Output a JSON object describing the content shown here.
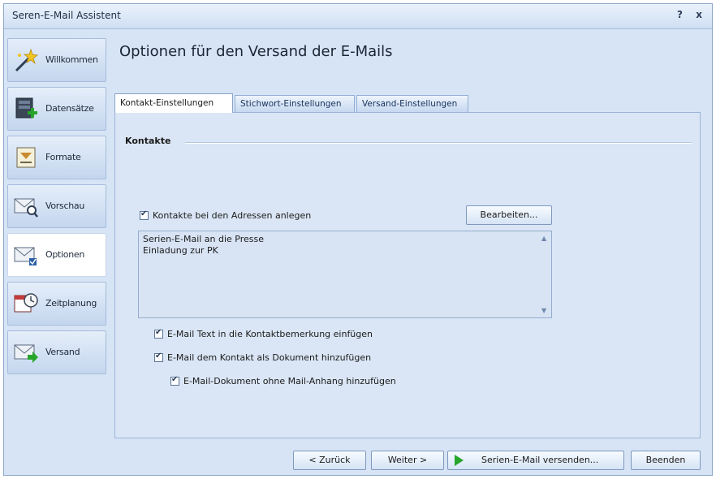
{
  "window": {
    "title": "Seren-E-Mail Assistent",
    "help_label": "?",
    "close_label": "x"
  },
  "sidebar": {
    "items": [
      {
        "label": "Willkommen",
        "icon": "magic-wand-icon",
        "active": false
      },
      {
        "label": "Datensätze",
        "icon": "database-add-icon",
        "active": false
      },
      {
        "label": "Formate",
        "icon": "format-icon",
        "active": false
      },
      {
        "label": "Vorschau",
        "icon": "mail-preview-icon",
        "active": false
      },
      {
        "label": "Optionen",
        "icon": "mail-options-icon",
        "active": true
      },
      {
        "label": "Zeitplanung",
        "icon": "calendar-clock-icon",
        "active": false
      },
      {
        "label": "Versand",
        "icon": "mail-send-icon",
        "active": false
      }
    ]
  },
  "main": {
    "heading": "Optionen für den Versand der E-Mails",
    "tabs": [
      {
        "label": "Kontakt-Einstellungen",
        "active": true
      },
      {
        "label": "Stichwort-Einstellungen",
        "active": false
      },
      {
        "label": "Versand-Einstellungen",
        "active": false
      }
    ],
    "group_title": "Kontakte",
    "create_contacts": {
      "label": "Kontakte bei den Adressen anlegen",
      "checked": true
    },
    "edit_button": "Bearbeiten...",
    "textarea_lines": [
      "Serien-E-Mail an die Presse",
      "Einladung zur PK"
    ],
    "options": [
      {
        "label": "E-Mail Text in die Kontaktbemerkung einfügen",
        "checked": true
      },
      {
        "label": "E-Mail dem Kontakt als Dokument hinzufügen",
        "checked": true
      },
      {
        "label": "E-Mail-Dokument ohne Mail-Anhang hinzufügen",
        "checked": true
      }
    ]
  },
  "footer": {
    "back": "< Zurück",
    "next": "Weiter >",
    "send": "Serien-E-Mail versenden...",
    "finish": "Beenden"
  },
  "colors": {
    "accent": "#25a52a",
    "window_bg": "#d6e4f5",
    "border": "#8ea6c8"
  }
}
